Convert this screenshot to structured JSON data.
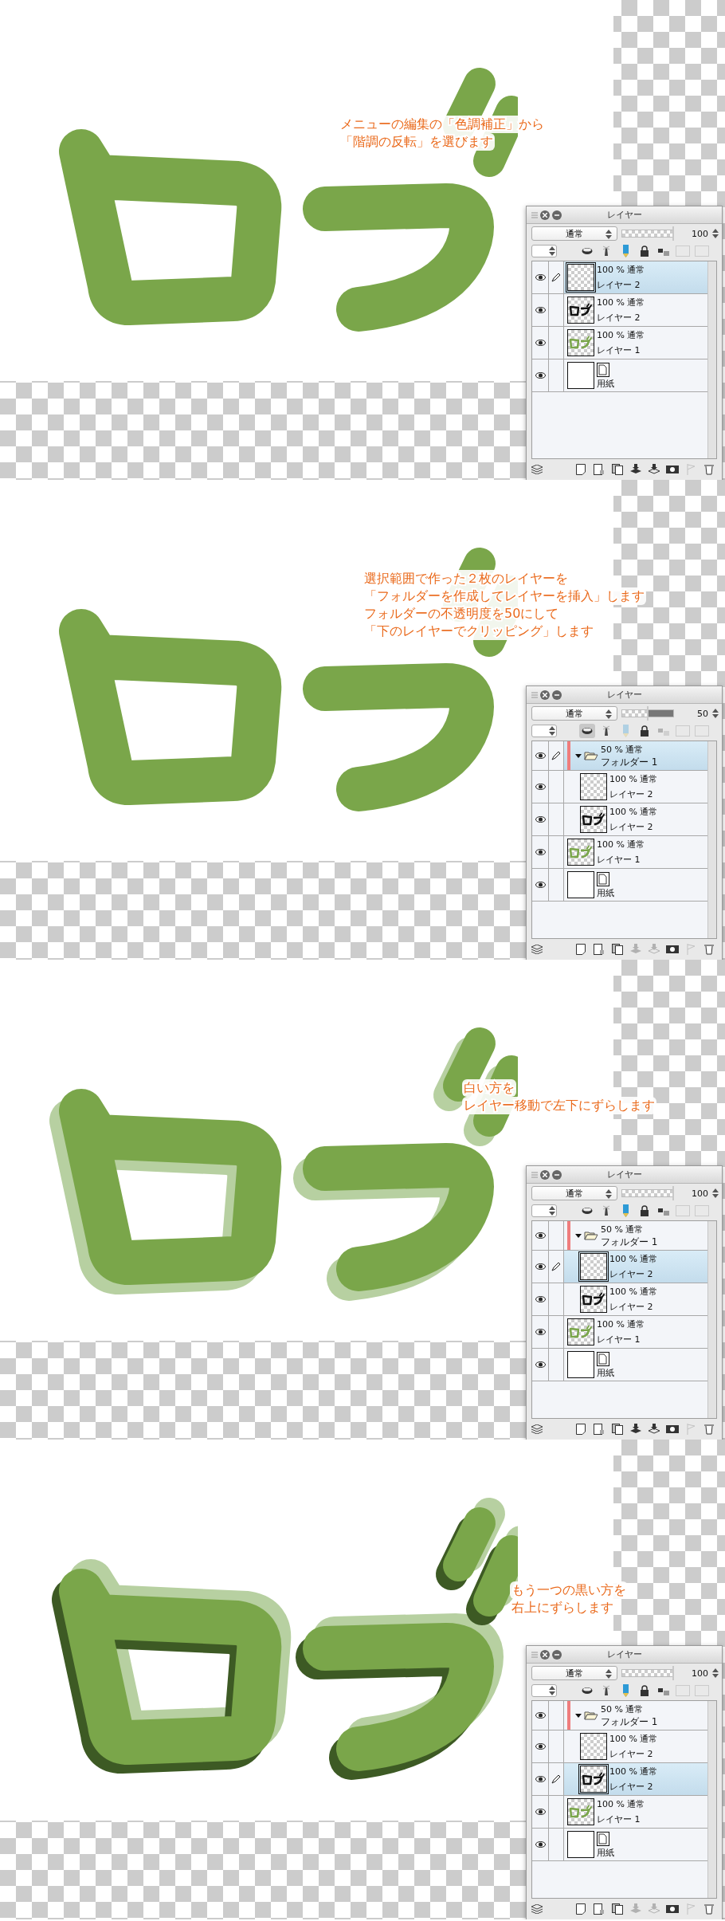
{
  "steps": [
    {
      "note": [
        "メニューの編集の「色調補正」から",
        "「階調の反転」を選びます"
      ],
      "logo": {
        "kind": "plain"
      },
      "panel": {
        "title": "レイヤー",
        "blend_mode": "通常",
        "opacity": "100",
        "level": 1,
        "toolbar": {
          "clip_selected": false,
          "color_disabled": false
        },
        "merge_disabled": false,
        "layers": [
          {
            "kind": "layer",
            "thumbnail": {
              "kind": "blank"
            },
            "opacity_mode": "100 % 通常",
            "name": "レイヤー 2",
            "selected": true,
            "editing": true
          },
          {
            "kind": "layer",
            "thumbnail": {
              "kind": "outline"
            },
            "opacity_mode": "100 % 通常",
            "name": "レイヤー 2",
            "selected": false,
            "editing": false
          },
          {
            "kind": "layer",
            "thumbnail": {
              "kind": "green"
            },
            "opacity_mode": "100 % 通常",
            "name": "レイヤー 1",
            "selected": false,
            "editing": false
          },
          {
            "kind": "paper",
            "name": "用紙",
            "selected": false,
            "editing": false
          }
        ]
      }
    },
    {
      "note": [
        "選択範囲で作った２枚のレイヤーを",
        "「フォルダーを作成してレイヤーを挿入」します",
        "フォルダーの不透明度を50にして",
        "「下のレイヤーでクリッピング」します"
      ],
      "logo": {
        "kind": "plain"
      },
      "panel": {
        "title": "レイヤー",
        "blend_mode": "通常",
        "opacity": "50",
        "level": 0.5,
        "toolbar": {
          "clip_selected": true,
          "color_disabled": true
        },
        "merge_disabled": true,
        "layers": [
          {
            "kind": "folder",
            "opacity_mode": "50 % 通常",
            "name": "フォルダー 1",
            "selected": true,
            "editing": true,
            "expanded": true,
            "children": [
              {
                "kind": "layer",
                "thumbnail": {
                  "kind": "blank"
                },
                "opacity_mode": "100 % 通常",
                "name": "レイヤー 2",
                "selected": false,
                "editing": false
              },
              {
                "kind": "layer",
                "thumbnail": {
                  "kind": "outline"
                },
                "opacity_mode": "100 % 通常",
                "name": "レイヤー 2",
                "selected": false,
                "editing": false
              }
            ]
          },
          {
            "kind": "layer",
            "thumbnail": {
              "kind": "green"
            },
            "opacity_mode": "100 % 通常",
            "name": "レイヤー 1",
            "selected": false,
            "editing": false
          },
          {
            "kind": "paper",
            "name": "用紙",
            "selected": false,
            "editing": false
          }
        ]
      }
    },
    {
      "note": [
        "白い方を",
        "レイヤー移動で左下にずらします"
      ],
      "logo": {
        "kind": "white-shifted"
      },
      "panel": {
        "title": "レイヤー",
        "blend_mode": "通常",
        "opacity": "100",
        "level": 1,
        "toolbar": {
          "clip_selected": false,
          "color_disabled": false
        },
        "merge_disabled": false,
        "layers": [
          {
            "kind": "folder",
            "opacity_mode": "50 % 通常",
            "name": "フォルダー 1",
            "selected": false,
            "editing": false,
            "expanded": true,
            "children": [
              {
                "kind": "layer",
                "thumbnail": {
                  "kind": "blank"
                },
                "opacity_mode": "100 % 通常",
                "name": "レイヤー 2",
                "selected": true,
                "editing": true
              },
              {
                "kind": "layer",
                "thumbnail": {
                  "kind": "outline"
                },
                "opacity_mode": "100 % 通常",
                "name": "レイヤー 2",
                "selected": false,
                "editing": false
              }
            ]
          },
          {
            "kind": "layer",
            "thumbnail": {
              "kind": "green"
            },
            "opacity_mode": "100 % 通常",
            "name": "レイヤー 1",
            "selected": false,
            "editing": false
          },
          {
            "kind": "paper",
            "name": "用紙",
            "selected": false,
            "editing": false
          }
        ]
      }
    },
    {
      "note": [
        "もう一つの黒い方を",
        "右上にずらします"
      ],
      "logo": {
        "kind": "both-shifted"
      },
      "panel": {
        "title": "レイヤー",
        "blend_mode": "通常",
        "opacity": "100",
        "level": 1,
        "toolbar": {
          "clip_selected": false,
          "color_disabled": false
        },
        "merge_disabled": true,
        "layers": [
          {
            "kind": "folder",
            "opacity_mode": "50 % 通常",
            "name": "フォルダー 1",
            "selected": false,
            "editing": false,
            "expanded": true,
            "children": [
              {
                "kind": "layer",
                "thumbnail": {
                  "kind": "blank"
                },
                "opacity_mode": "100 % 通常",
                "name": "レイヤー 2",
                "selected": false,
                "editing": false
              },
              {
                "kind": "layer",
                "thumbnail": {
                  "kind": "outline"
                },
                "opacity_mode": "100 % 通常",
                "name": "レイヤー 2",
                "selected": true,
                "editing": true
              }
            ]
          },
          {
            "kind": "layer",
            "thumbnail": {
              "kind": "green"
            },
            "opacity_mode": "100 % 通常",
            "name": "レイヤー 1",
            "selected": false,
            "editing": false
          },
          {
            "kind": "paper",
            "name": "用紙",
            "selected": false,
            "editing": false
          }
        ]
      }
    }
  ]
}
